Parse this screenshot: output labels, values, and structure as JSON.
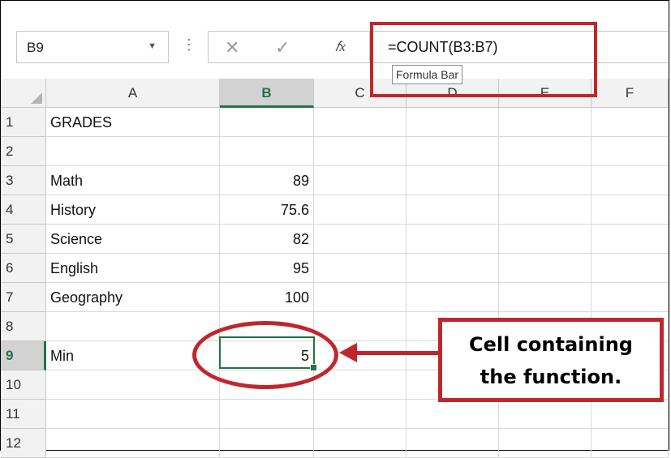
{
  "formula_bar": {
    "name_box": "B9",
    "formula": "=COUNT(B3:B7)",
    "fx_label": "fx",
    "tooltip": "Formula Bar"
  },
  "columns": [
    "A",
    "B",
    "C",
    "D",
    "E",
    "F"
  ],
  "rows": [
    {
      "num": "1",
      "a": "GRADES",
      "b": ""
    },
    {
      "num": "2",
      "a": "",
      "b": ""
    },
    {
      "num": "3",
      "a": "Math",
      "b": "89"
    },
    {
      "num": "4",
      "a": "History",
      "b": "75.6"
    },
    {
      "num": "5",
      "a": "Science",
      "b": "82"
    },
    {
      "num": "6",
      "a": "English",
      "b": "95"
    },
    {
      "num": "7",
      "a": "Geography",
      "b": "100"
    },
    {
      "num": "8",
      "a": "",
      "b": ""
    },
    {
      "num": "9",
      "a": "Min",
      "b": "5"
    },
    {
      "num": "10",
      "a": "",
      "b": ""
    },
    {
      "num": "11",
      "a": "",
      "b": ""
    },
    {
      "num": "12",
      "a": "",
      "b": ""
    }
  ],
  "annotation": {
    "line1": "Cell containing",
    "line2": "the function."
  },
  "colors": {
    "accent": "#217346",
    "annotation_red": "#c0272d"
  }
}
